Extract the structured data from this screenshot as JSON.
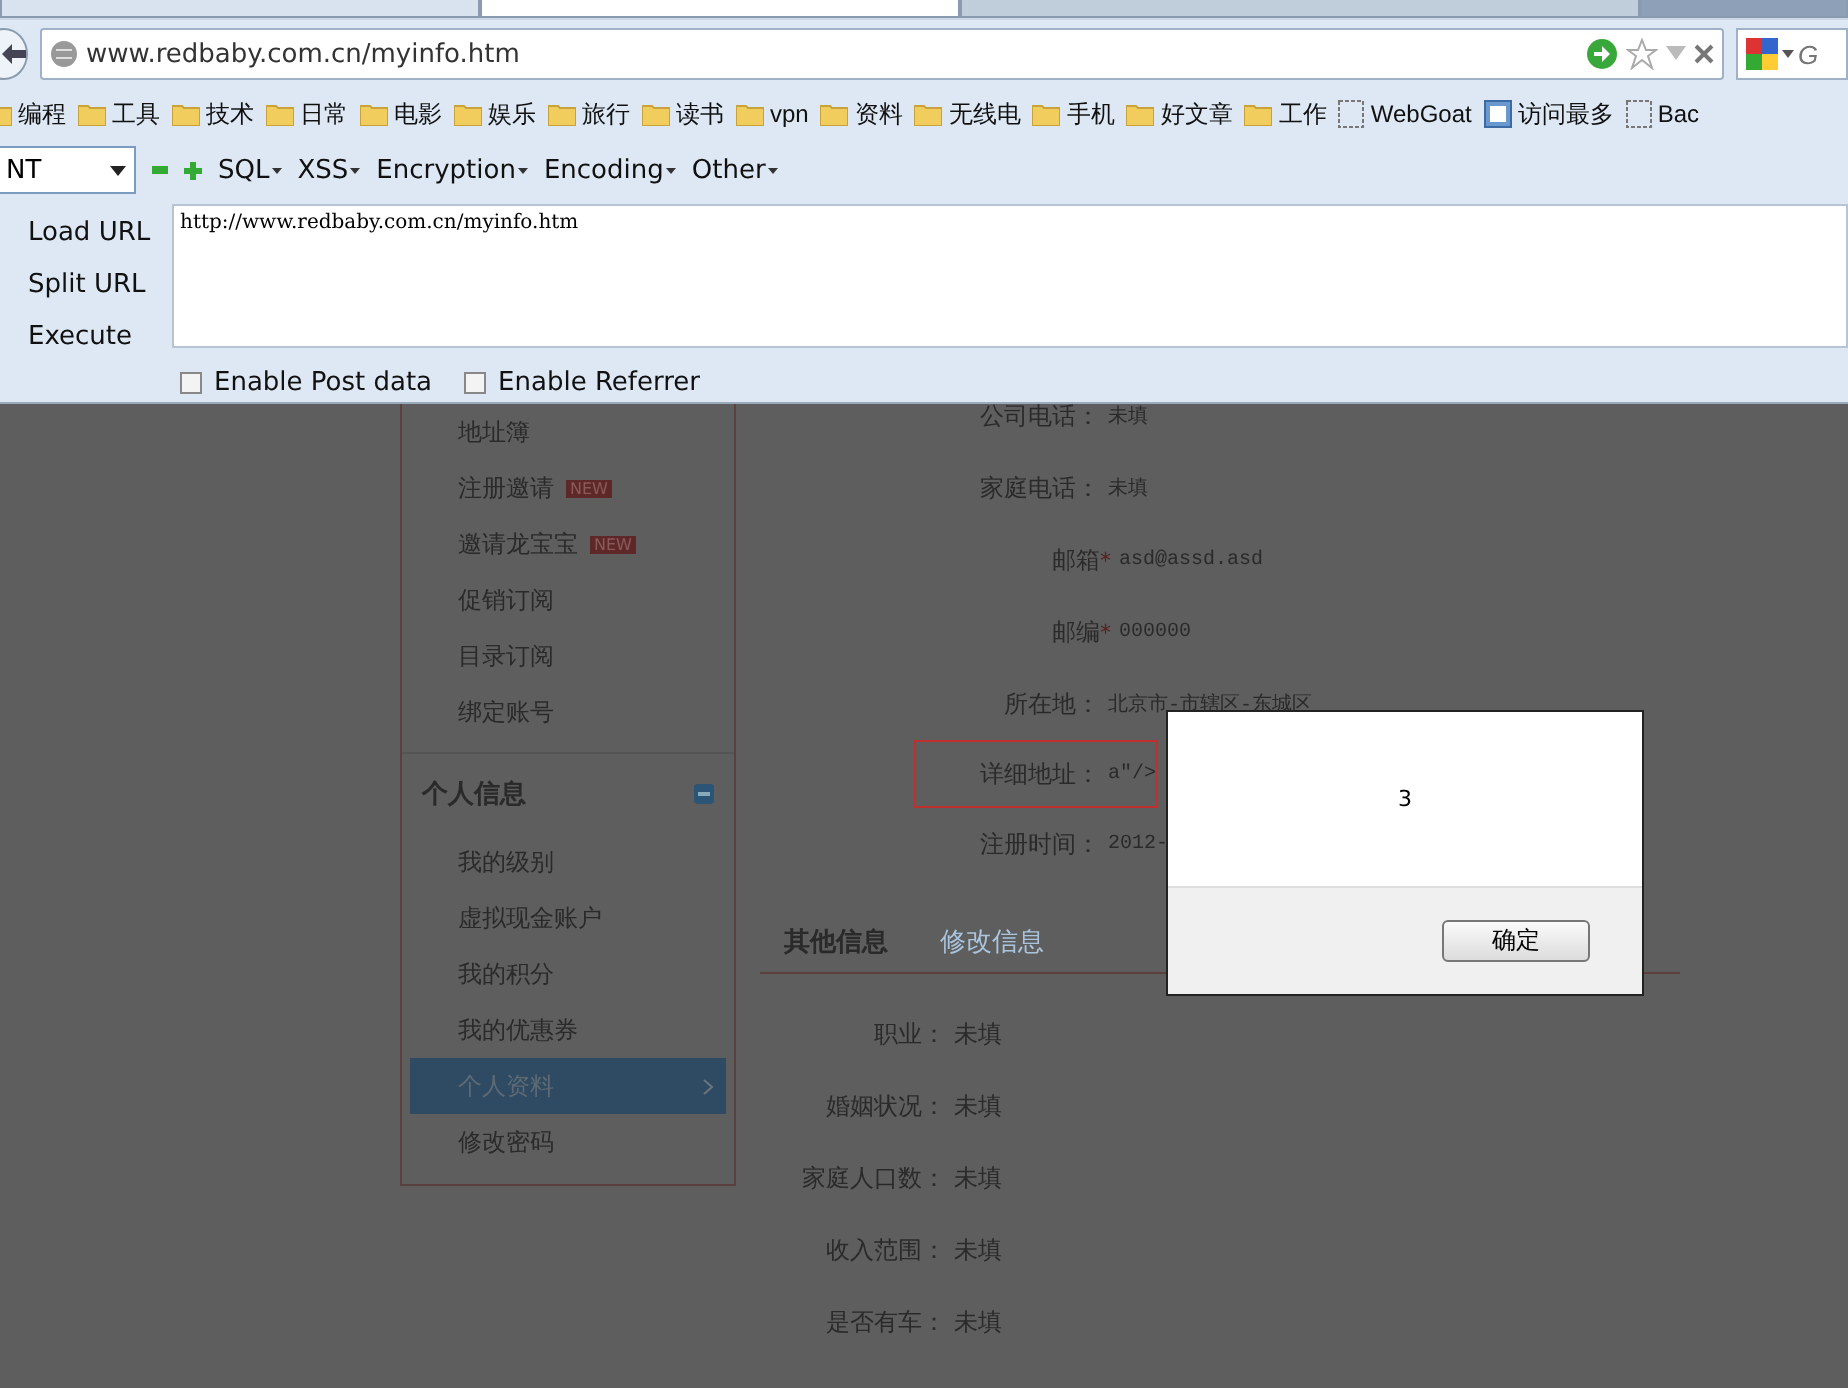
{
  "address_bar": {
    "url": "www.redbaby.com.cn/myinfo.htm"
  },
  "search": {
    "placeholder": "G"
  },
  "bookmarks": [
    {
      "kind": "folder",
      "label": "编程"
    },
    {
      "kind": "folder",
      "label": "工具"
    },
    {
      "kind": "folder",
      "label": "技术"
    },
    {
      "kind": "folder",
      "label": "日常"
    },
    {
      "kind": "folder",
      "label": "电影"
    },
    {
      "kind": "folder",
      "label": "娱乐"
    },
    {
      "kind": "folder",
      "label": "旅行"
    },
    {
      "kind": "folder",
      "label": "读书"
    },
    {
      "kind": "folder",
      "label": "vpn"
    },
    {
      "kind": "folder",
      "label": "资料"
    },
    {
      "kind": "folder",
      "label": "无线电"
    },
    {
      "kind": "folder",
      "label": "手机"
    },
    {
      "kind": "folder",
      "label": "好文章"
    },
    {
      "kind": "folder",
      "label": "工作"
    },
    {
      "kind": "page",
      "label": "WebGoat"
    },
    {
      "kind": "smart",
      "label": "访问最多"
    },
    {
      "kind": "page",
      "label": "Bac"
    }
  ],
  "hackbar": {
    "dropdown": "NT",
    "menus": [
      "SQL",
      "XSS",
      "Encryption",
      "Encoding",
      "Other"
    ],
    "actions": [
      "Load URL",
      "Split URL",
      "Execute"
    ],
    "url_text": "http://www.redbaby.com.cn/myinfo.htm",
    "options": [
      {
        "label": "Enable Post data",
        "checked": false
      },
      {
        "label": "Enable Referrer",
        "checked": false
      }
    ]
  },
  "sidebar": {
    "items": [
      {
        "kind": "item",
        "label": "地址簿",
        "selected": false
      },
      {
        "kind": "item",
        "label": "注册邀请",
        "badge": "NEW",
        "selected": false
      },
      {
        "kind": "item",
        "label": "邀请龙宝宝",
        "badge": "NEW",
        "selected": false
      },
      {
        "kind": "item",
        "label": "促销订阅",
        "selected": false
      },
      {
        "kind": "item",
        "label": "目录订阅",
        "selected": false
      },
      {
        "kind": "item",
        "label": "绑定账号",
        "selected": false
      },
      {
        "kind": "section",
        "label": "个人信息",
        "expanded": true
      },
      {
        "kind": "item",
        "label": "我的级别",
        "selected": false
      },
      {
        "kind": "item",
        "label": "虚拟现金账户",
        "selected": false
      },
      {
        "kind": "item",
        "label": "我的积分",
        "selected": false
      },
      {
        "kind": "item",
        "label": "我的优惠券",
        "selected": false
      },
      {
        "kind": "item",
        "label": "个人资料",
        "selected": true
      },
      {
        "kind": "item",
        "label": "修改密码",
        "selected": false
      }
    ]
  },
  "profile_fields": [
    {
      "label": "公司电话：",
      "value": "未填",
      "highlighted": false
    },
    {
      "label": "家庭电话：",
      "value": "未填",
      "highlighted": false
    },
    {
      "label": "邮箱",
      "mark": "*",
      "value": "asd@assd.asd",
      "highlighted": false
    },
    {
      "label": "邮编",
      "mark": "*",
      "value": "000000",
      "highlighted": false
    },
    {
      "label": "所在地：",
      "value": "北京市-市辖区-东城区",
      "highlighted": false
    },
    {
      "label": "详细地址：",
      "value": "a\"/>",
      "highlighted": true
    },
    {
      "label": "注册时间：",
      "value": "2012-",
      "highlighted": false
    }
  ],
  "section_tabs": [
    {
      "label": "其他信息",
      "selected": true
    },
    {
      "label": "修改信息",
      "selected": false
    }
  ],
  "other_fields": [
    {
      "label": "职业：",
      "value": "未填"
    },
    {
      "label": "婚姻状况：",
      "value": "未填"
    },
    {
      "label": "家庭人口数：",
      "value": "未填"
    },
    {
      "label": "收入范围：",
      "value": "未填"
    },
    {
      "label": "是否有车：",
      "value": "未填"
    }
  ],
  "dialog": {
    "message": "3",
    "button": "确定"
  }
}
